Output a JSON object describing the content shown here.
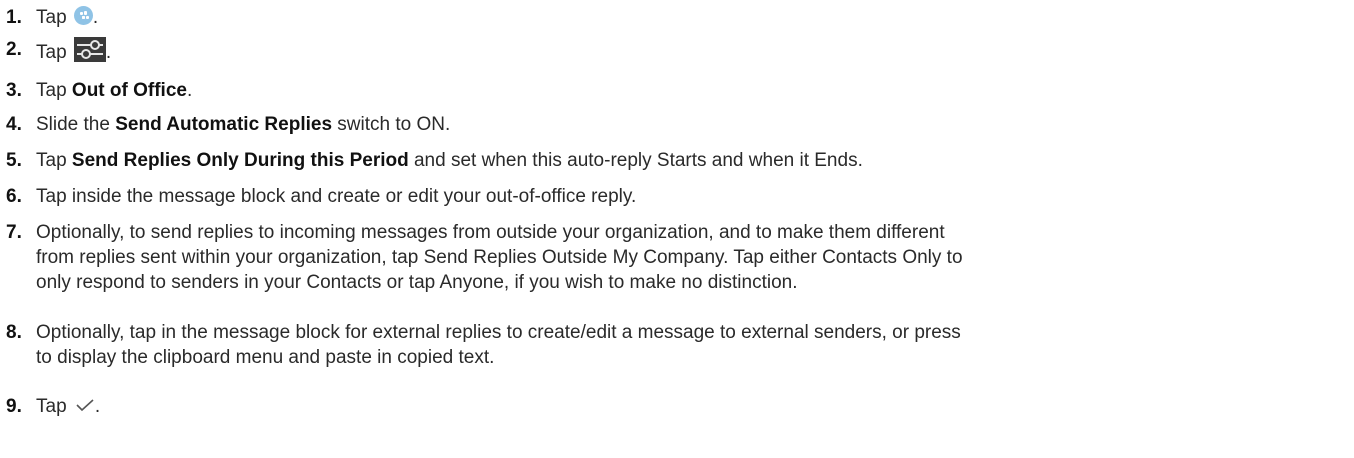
{
  "steps": [
    {
      "number": "1.",
      "parts": {
        "a": "Tap ",
        "b": "."
      },
      "icon": "bbm-icon"
    },
    {
      "number": "2.",
      "parts": {
        "a": "Tap ",
        "b": "."
      },
      "icon": "settings-sliders-icon"
    },
    {
      "number": "3.",
      "parts": {
        "a": "Tap ",
        "bold": "Out of Office",
        "b": "."
      }
    },
    {
      "number": "4.",
      "parts": {
        "a": "Slide the ",
        "bold": "Send Automatic Replies",
        "b": " switch to ON."
      }
    },
    {
      "number": "5.",
      "parts": {
        "a": "Tap ",
        "bold": "Send Replies Only During this Period",
        "b": " and set when this auto-reply Starts and when it Ends."
      }
    },
    {
      "number": "6.",
      "parts": {
        "a": "Tap inside the message block and create or edit your out-of-office reply."
      }
    },
    {
      "number": "7.",
      "lines": [
        "Optionally, to send replies to incoming messages from outside your organization, and to make them different",
        "from replies sent within your organization, tap Send Replies Outside My Company. Tap either Contacts Only to",
        "only respond to senders in your Contacts or tap Anyone, if you wish to make no distinction."
      ]
    },
    {
      "number": "8.",
      "lines": [
        "Optionally, tap in the message block for external replies to create/edit a message to external senders, or press",
        "to display the clipboard menu and paste in copied text."
      ]
    },
    {
      "number": "9.",
      "parts": {
        "a": "Tap ",
        "b": "."
      },
      "icon": "checkmark-icon"
    }
  ],
  "colors": {
    "text": "#2a2a2a",
    "bbm_icon": "#8fc3e6",
    "settings_icon_bg": "#3a3a3a"
  }
}
